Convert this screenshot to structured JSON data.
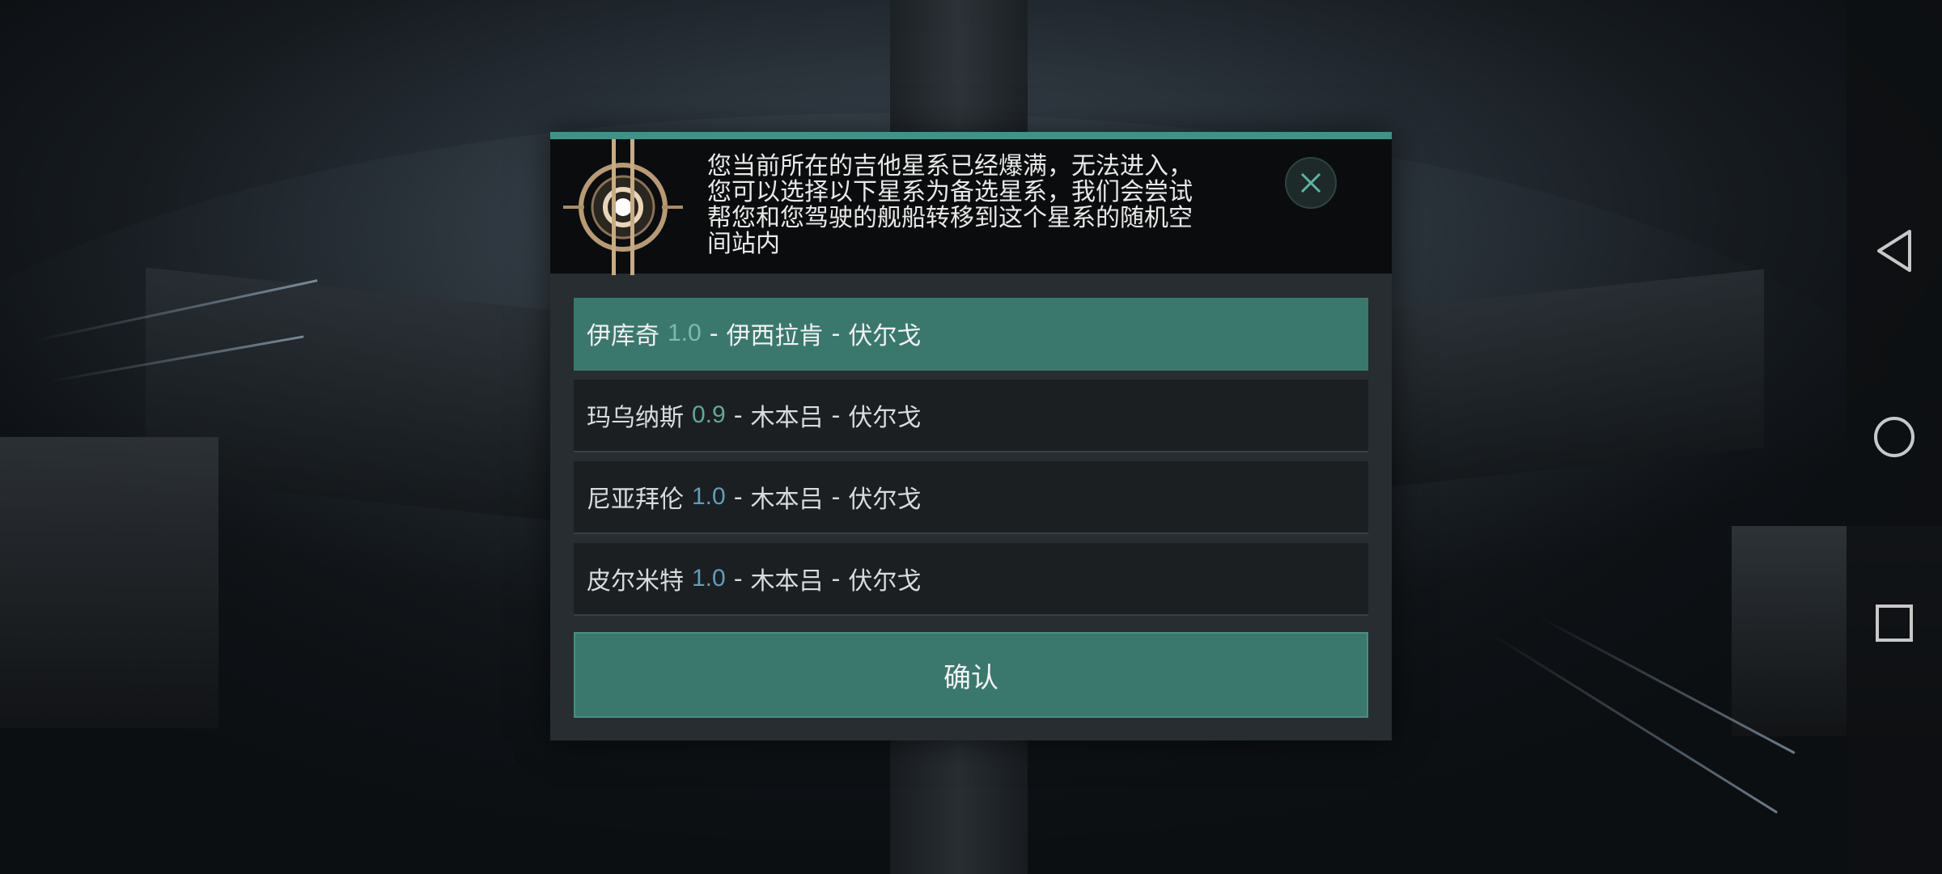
{
  "dialog": {
    "message": "您当前所在的吉他星系已经爆满，无法进入，\n您可以选择以下星系为备选星系，我们会尝试\n帮您和您驾驶的舰船转移到这个星系的随机空\n间站内",
    "close_icon": "close-icon",
    "emblem_icon": "target-emblem-icon",
    "confirm_label": "确认",
    "systems": [
      {
        "name": "伊库奇",
        "security": "1.0",
        "sep1": "-",
        "constellation": "伊西拉肯",
        "sep2": "-",
        "region": "伏尔戈",
        "selected": true,
        "security_color": "#7fb8ad"
      },
      {
        "name": "玛乌纳斯",
        "security": "0.9",
        "sep1": "-",
        "constellation": "木本吕",
        "sep2": "-",
        "region": "伏尔戈",
        "selected": false,
        "security_color": "#5fa89b"
      },
      {
        "name": "尼亚拜伦",
        "security": "1.0",
        "sep1": "-",
        "constellation": "木本吕",
        "sep2": "-",
        "region": "伏尔戈",
        "selected": false,
        "security_color": "#5f9ec0"
      },
      {
        "name": "皮尔米特",
        "security": "1.0",
        "sep1": "-",
        "constellation": "木本吕",
        "sep2": "-",
        "region": "伏尔戈",
        "selected": false,
        "security_color": "#5f9ec0"
      }
    ]
  },
  "colors": {
    "accent": "#3a786e",
    "top_line": "#3e9387",
    "header_bg": "#0b0c0d",
    "dialog_bg": "#272d31",
    "row_bg": "#1b1f22"
  },
  "navbar": {
    "back_icon": "back-triangle-icon",
    "home_icon": "home-circle-icon",
    "recents_icon": "recents-square-icon"
  }
}
